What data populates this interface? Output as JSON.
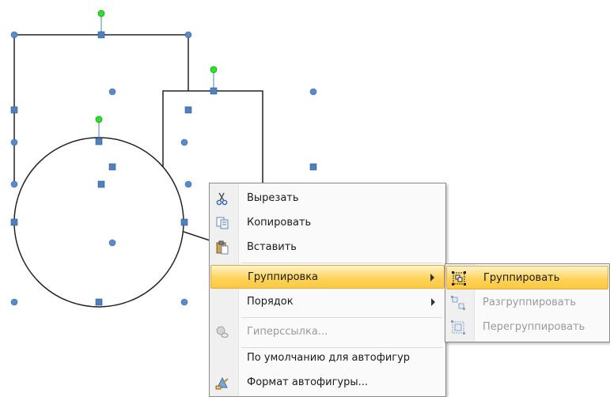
{
  "context_menu": {
    "items": [
      {
        "label": "Вырезать",
        "icon": "scissors-icon",
        "enabled": true
      },
      {
        "label": "Копировать",
        "icon": "copy-icon",
        "enabled": true
      },
      {
        "label": "Вставить",
        "icon": "paste-icon",
        "enabled": true
      },
      {
        "label": "Группировка",
        "icon": "",
        "enabled": true,
        "submenu": true,
        "highlighted": true
      },
      {
        "label": "Порядок",
        "icon": "",
        "enabled": true,
        "submenu": true
      },
      {
        "label": "Гиперссылка...",
        "icon": "hyperlink-icon",
        "enabled": false
      },
      {
        "label": "По умолчанию для автофигур",
        "icon": "",
        "enabled": true
      },
      {
        "label": "Формат автофигуры...",
        "icon": "format-shape-icon",
        "enabled": true
      }
    ]
  },
  "submenu": {
    "items": [
      {
        "label": "Группировать",
        "icon": "group-icon",
        "enabled": true,
        "highlighted": true
      },
      {
        "label": "Разгруппировать",
        "icon": "ungroup-icon",
        "enabled": false
      },
      {
        "label": "Перегруппировать",
        "icon": "regroup-icon",
        "enabled": false
      }
    ]
  },
  "colors": {
    "handle_square": "#4f81bd",
    "handle_dot": "#5a8acb",
    "rotation_handle": "#2ee02e",
    "highlight": "#ffd35c"
  }
}
